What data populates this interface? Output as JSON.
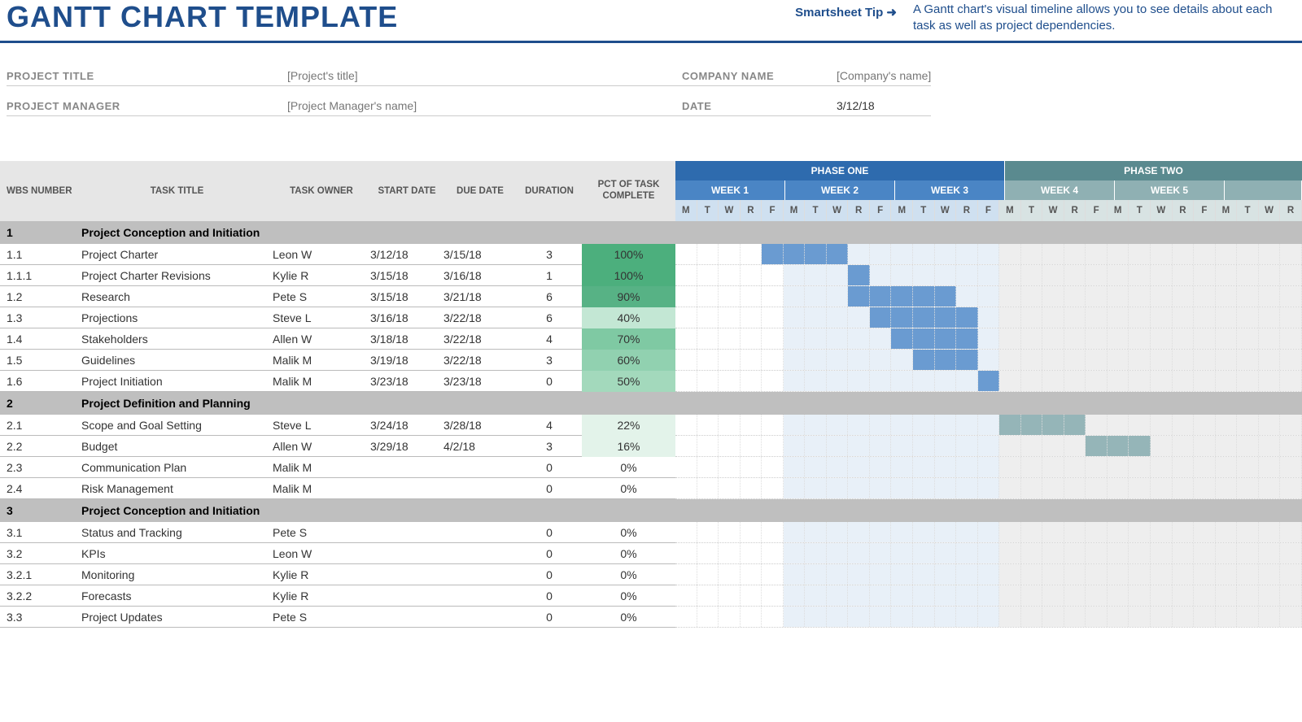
{
  "header": {
    "title": "GANTT CHART TEMPLATE",
    "tip_link": "Smartsheet Tip ➜",
    "tip_text": "A Gantt chart's visual timeline allows you to see details about each task as well as project dependencies."
  },
  "meta": {
    "project_title_label": "PROJECT TITLE",
    "project_title_value": "[Project's title]",
    "project_manager_label": "PROJECT MANAGER",
    "project_manager_value": "[Project Manager's name]",
    "company_name_label": "COMPANY NAME",
    "company_name_value": "[Company's name]",
    "date_label": "DATE",
    "date_value": "3/12/18"
  },
  "columns": {
    "wbs": "WBS NUMBER",
    "title": "TASK TITLE",
    "owner": "TASK OWNER",
    "start": "START DATE",
    "due": "DUE DATE",
    "duration": "DURATION",
    "pct": "PCT OF TASK COMPLETE"
  },
  "phases": {
    "one": "PHASE ONE",
    "two": "PHASE TWO"
  },
  "weeks": [
    "WEEK 1",
    "WEEK 2",
    "WEEK 3",
    "WEEK 4",
    "WEEK 5"
  ],
  "days": [
    "M",
    "T",
    "W",
    "R",
    "F"
  ],
  "chart_data": {
    "type": "gantt",
    "timeline": {
      "start": "3/12/18",
      "days_per_week": 5,
      "weeks": 5,
      "day_labels": [
        "M",
        "T",
        "W",
        "R",
        "F"
      ],
      "phase_split_week": 3
    },
    "sections": [
      {
        "wbs": "1",
        "title": "Project Conception and Initiation",
        "tasks": [
          {
            "wbs": "1.1",
            "title": "Project Charter",
            "owner": "Leon W",
            "start": "3/12/18",
            "due": "3/15/18",
            "duration": 3,
            "pct": 100,
            "bar_start": 4,
            "bar_len": 4
          },
          {
            "wbs": "1.1.1",
            "title": "Project Charter Revisions",
            "owner": "Kylie R",
            "start": "3/15/18",
            "due": "3/16/18",
            "duration": 1,
            "pct": 100,
            "bar_start": 8,
            "bar_len": 1
          },
          {
            "wbs": "1.2",
            "title": "Research",
            "owner": "Pete S",
            "start": "3/15/18",
            "due": "3/21/18",
            "duration": 6,
            "pct": 90,
            "bar_start": 8,
            "bar_len": 5
          },
          {
            "wbs": "1.3",
            "title": "Projections",
            "owner": "Steve L",
            "start": "3/16/18",
            "due": "3/22/18",
            "duration": 6,
            "pct": 40,
            "bar_start": 9,
            "bar_len": 5
          },
          {
            "wbs": "1.4",
            "title": "Stakeholders",
            "owner": "Allen W",
            "start": "3/18/18",
            "due": "3/22/18",
            "duration": 4,
            "pct": 70,
            "bar_start": 10,
            "bar_len": 4
          },
          {
            "wbs": "1.5",
            "title": "Guidelines",
            "owner": "Malik M",
            "start": "3/19/18",
            "due": "3/22/18",
            "duration": 3,
            "pct": 60,
            "bar_start": 11,
            "bar_len": 3
          },
          {
            "wbs": "1.6",
            "title": "Project Initiation",
            "owner": "Malik M",
            "start": "3/23/18",
            "due": "3/23/18",
            "duration": 0,
            "pct": 50,
            "bar_start": 14,
            "bar_len": 1
          }
        ]
      },
      {
        "wbs": "2",
        "title": "Project Definition and Planning",
        "tasks": [
          {
            "wbs": "2.1",
            "title": "Scope and Goal Setting",
            "owner": "Steve L",
            "start": "3/24/18",
            "due": "3/28/18",
            "duration": 4,
            "pct": 22,
            "bar_start": 15,
            "bar_len": 4,
            "phase": 2
          },
          {
            "wbs": "2.2",
            "title": "Budget",
            "owner": "Allen W",
            "start": "3/29/18",
            "due": "4/2/18",
            "duration": 3,
            "pct": 16,
            "bar_start": 19,
            "bar_len": 3,
            "phase": 2
          },
          {
            "wbs": "2.3",
            "title": "Communication Plan",
            "owner": "Malik M",
            "start": "",
            "due": "",
            "duration": 0,
            "pct": 0
          },
          {
            "wbs": "2.4",
            "title": "Risk Management",
            "owner": "Malik M",
            "start": "",
            "due": "",
            "duration": 0,
            "pct": 0
          }
        ]
      },
      {
        "wbs": "3",
        "title": "Project Conception and Initiation",
        "tasks": [
          {
            "wbs": "3.1",
            "title": "Status and Tracking",
            "owner": "Pete S",
            "start": "",
            "due": "",
            "duration": 0,
            "pct": 0
          },
          {
            "wbs": "3.2",
            "title": "KPIs",
            "owner": "Leon W",
            "start": "",
            "due": "",
            "duration": 0,
            "pct": 0
          },
          {
            "wbs": "3.2.1",
            "title": "Monitoring",
            "owner": "Kylie R",
            "start": "",
            "due": "",
            "duration": 0,
            "pct": 0
          },
          {
            "wbs": "3.2.2",
            "title": "Forecasts",
            "owner": "Kylie R",
            "start": "",
            "due": "",
            "duration": 0,
            "pct": 0
          },
          {
            "wbs": "3.3",
            "title": "Project Updates",
            "owner": "Pete S",
            "start": "",
            "due": "",
            "duration": 0,
            "pct": 0
          }
        ]
      }
    ]
  }
}
